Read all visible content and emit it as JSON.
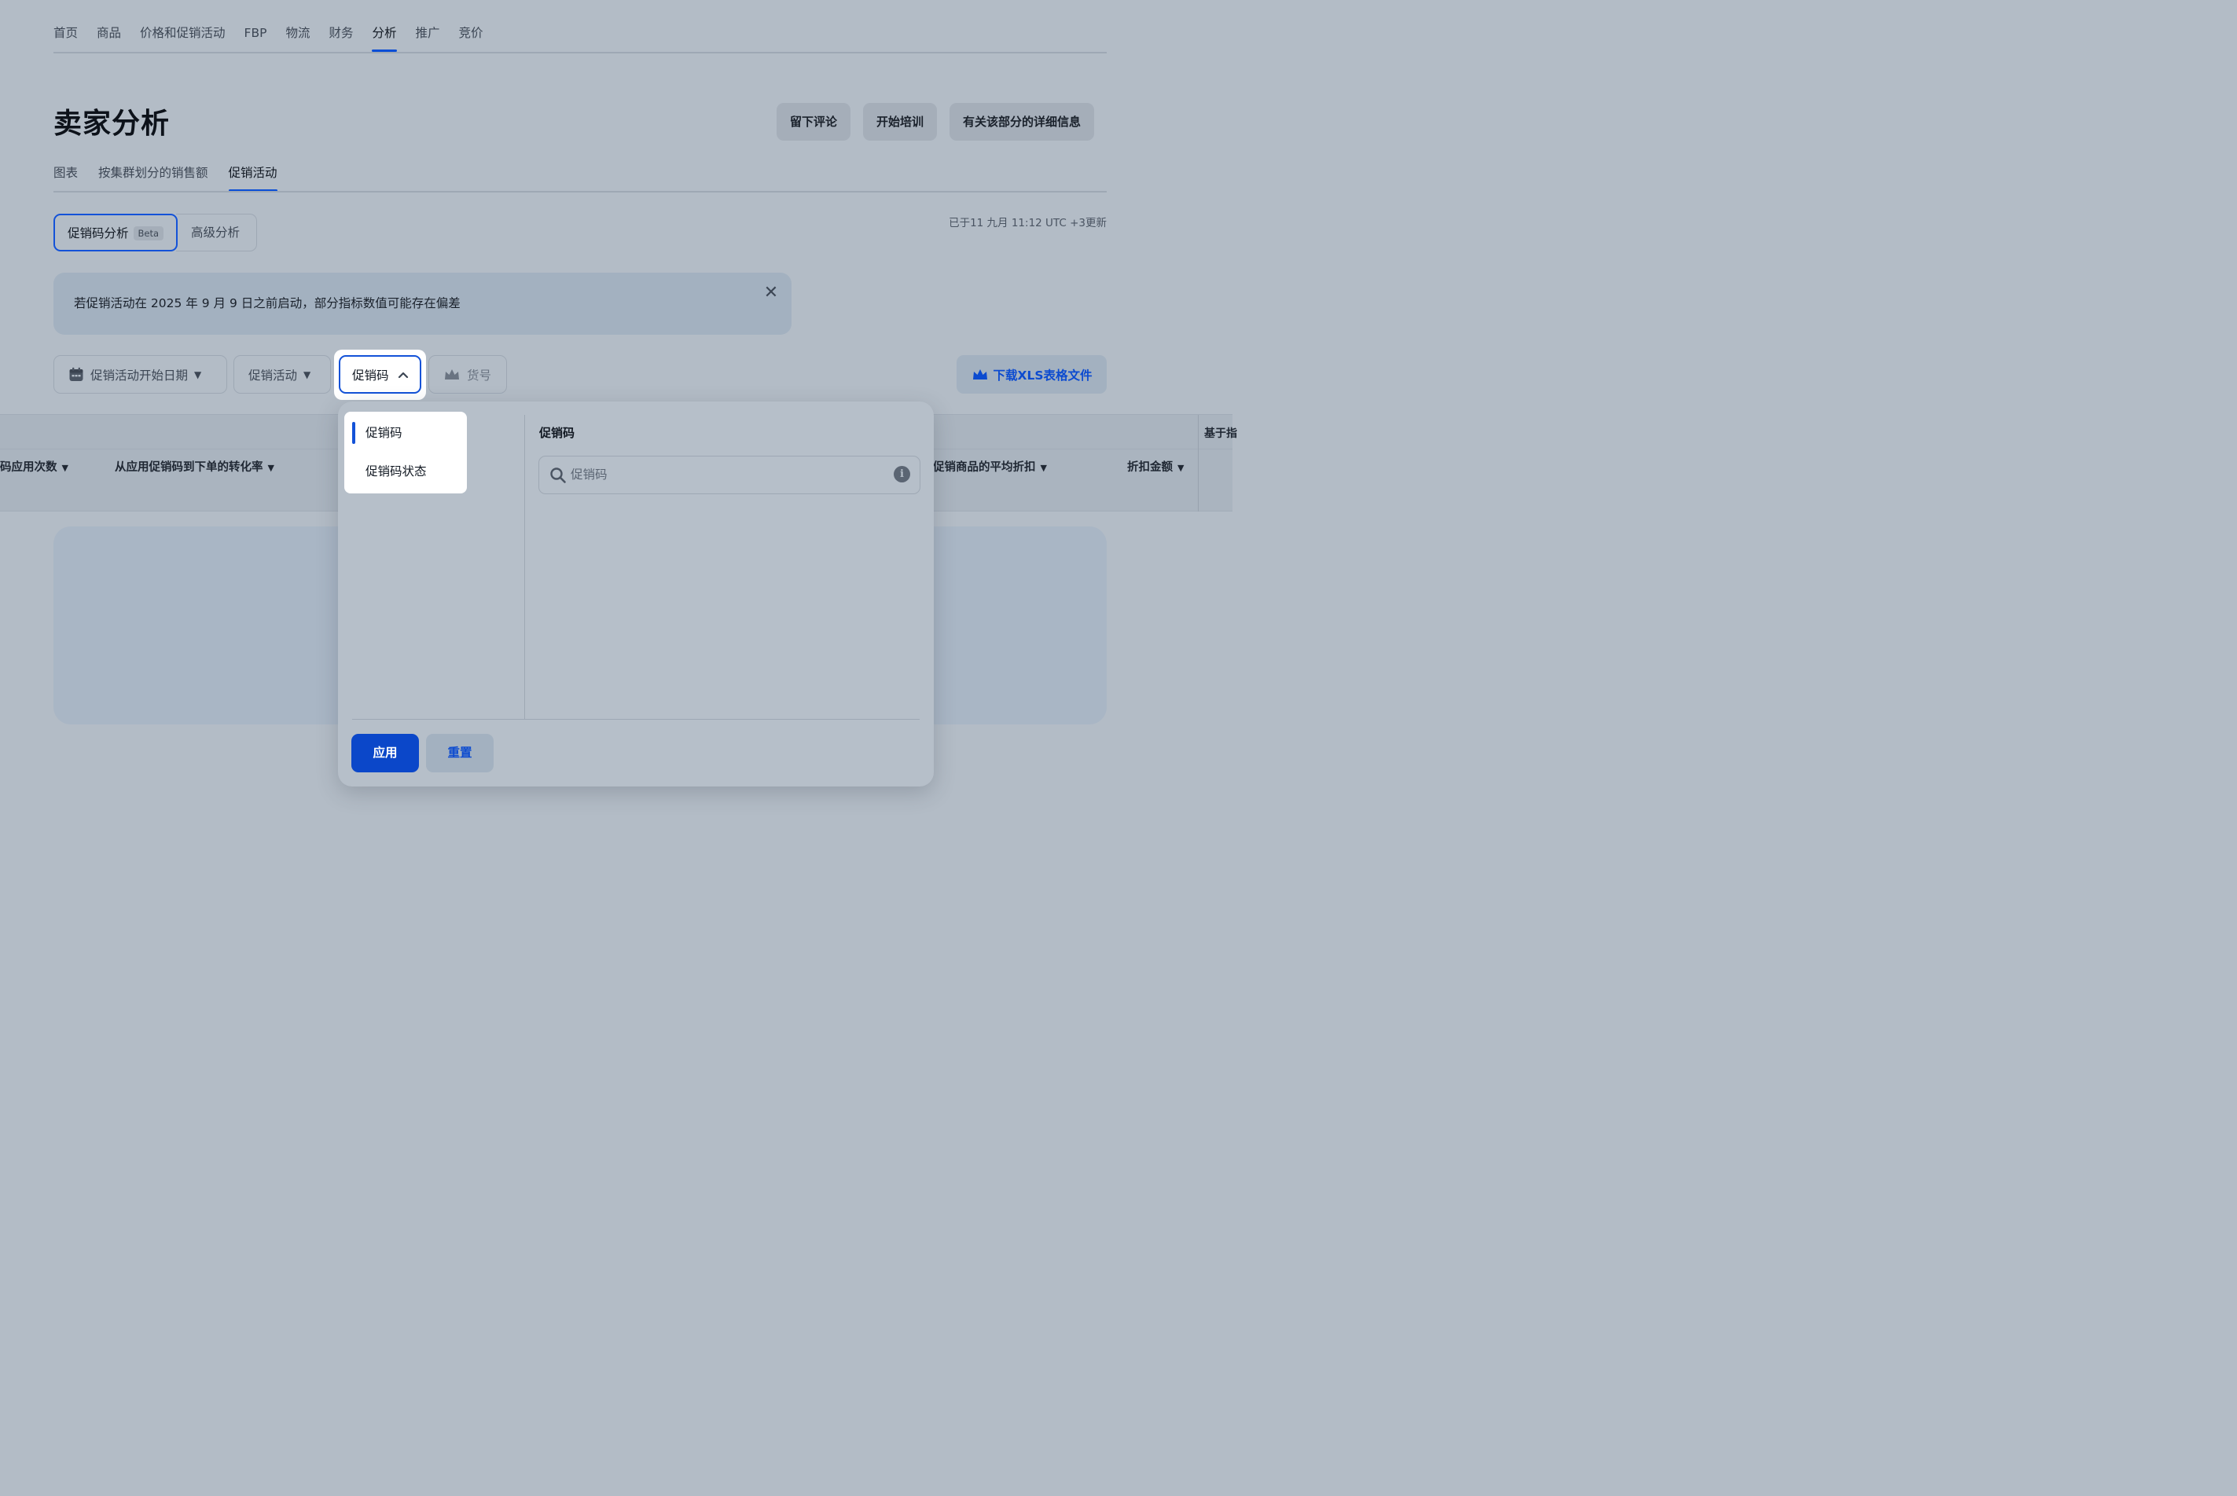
{
  "colors": {
    "accent": "#1352d8",
    "primary_button": "#0b47c9",
    "link_blue": "#0c4bd0",
    "overlay_background": "#b3bcc6",
    "popup_background": "#b6bfc9",
    "banner_background": "#a3b1c0"
  },
  "nav": {
    "items": [
      "首页",
      "商品",
      "价格和促销活动",
      "FBP",
      "物流",
      "财务",
      "分析",
      "推广",
      "竞价"
    ],
    "active": "分析"
  },
  "header": {
    "title": "卖家分析",
    "buttons": {
      "feedback": "留下评论",
      "training": "开始培训",
      "details": "有关该部分的详细信息"
    }
  },
  "subtabs": {
    "items": [
      "图表",
      "按集群划分的销售额",
      "促销活动"
    ],
    "active": "促销活动"
  },
  "segment": {
    "promo_code_analytics": "促销码分析",
    "beta_badge": "Beta",
    "advanced_analytics": "高级分析"
  },
  "updated_text": "已于11 九月 11:12 UTC +3更新",
  "banner": {
    "text": "若促销活动在 2025 年 9 月 9 日之前启动，部分指标数值可能存在偏差",
    "close_icon": "close-icon"
  },
  "filters": {
    "start_date": "促销活动开始日期",
    "campaign": "促销活动",
    "promo_code": "促销码",
    "sku": "货号",
    "icons": {
      "start_date": "calendar-icon",
      "sku": "crown-icon",
      "download": "crown-icon"
    }
  },
  "download_button": "下载XLS表格文件",
  "table": {
    "group_header_partial": "基于指",
    "columns": {
      "applications_partial": "码应用次数",
      "conversion": "从应用促销码到下单的转化率",
      "avg_discount_partial": "促销商品的平均折扣",
      "discount_amount": "折扣金额"
    }
  },
  "popup": {
    "menu_items": [
      "促销码",
      "促销码状态"
    ],
    "selected": "促销码",
    "section_label": "促销码",
    "search_placeholder": "促销码",
    "search_value": "",
    "info_icon": "info-icon",
    "apply_button": "应用",
    "reset_button": "重置"
  }
}
